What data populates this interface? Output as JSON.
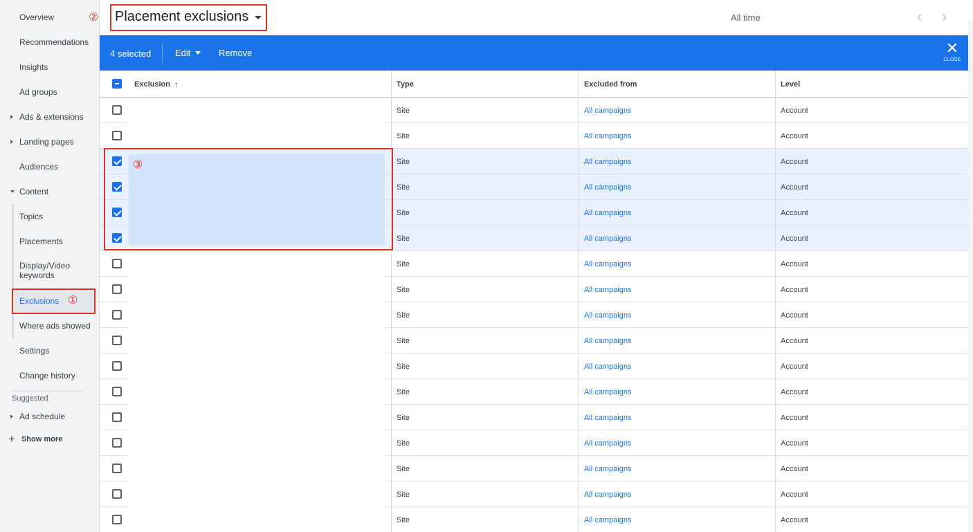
{
  "sidebar": {
    "items": [
      {
        "label": "Overview"
      },
      {
        "label": "Recommendations"
      },
      {
        "label": "Insights"
      },
      {
        "label": "Ad groups"
      },
      {
        "label": "Ads & extensions"
      },
      {
        "label": "Landing pages"
      },
      {
        "label": "Audiences"
      },
      {
        "label": "Content"
      },
      {
        "label": "Topics"
      },
      {
        "label": "Placements"
      },
      {
        "label": "Display/Video keywords"
      },
      {
        "label": "Exclusions"
      },
      {
        "label": "Where ads showed"
      },
      {
        "label": "Settings"
      },
      {
        "label": "Change history"
      }
    ],
    "suggested_label": "Suggested",
    "suggested_items": [
      {
        "label": "Ad schedule"
      }
    ],
    "show_more_label": "Show more"
  },
  "annotations": {
    "one": "①",
    "two": "②",
    "three": "③"
  },
  "header": {
    "title": "Placement exclusions",
    "date_range": "All time",
    "prev_icon": "‹",
    "next_icon": "›"
  },
  "selection_bar": {
    "count_label": "4 selected",
    "edit_label": "Edit",
    "remove_label": "Remove",
    "close_icon": "✕",
    "close_label": "CLOSE"
  },
  "table": {
    "columns": {
      "exclusion": "Exclusion",
      "type": "Type",
      "excluded_from": "Excluded from",
      "level": "Level"
    },
    "sort_icon": "↑",
    "rows": [
      {
        "type": "Site",
        "excluded_from": "All campaigns",
        "level": "Account"
      },
      {
        "type": "Site",
        "excluded_from": "All campaigns",
        "level": "Account"
      },
      {
        "type": "Site",
        "excluded_from": "All campaigns",
        "level": "Account"
      },
      {
        "type": "Site",
        "excluded_from": "All campaigns",
        "level": "Account"
      },
      {
        "type": "Site",
        "excluded_from": "All campaigns",
        "level": "Account"
      },
      {
        "type": "Site",
        "excluded_from": "All campaigns",
        "level": "Account"
      },
      {
        "type": "Site",
        "excluded_from": "All campaigns",
        "level": "Account"
      },
      {
        "type": "Site",
        "excluded_from": "All campaigns",
        "level": "Account"
      },
      {
        "type": "Site",
        "excluded_from": "All campaigns",
        "level": "Account"
      },
      {
        "type": "Site",
        "excluded_from": "All campaigns",
        "level": "Account"
      },
      {
        "type": "Site",
        "excluded_from": "All campaigns",
        "level": "Account"
      },
      {
        "type": "Site",
        "excluded_from": "All campaigns",
        "level": "Account"
      },
      {
        "type": "Site",
        "excluded_from": "All campaigns",
        "level": "Account"
      },
      {
        "type": "Site",
        "excluded_from": "All campaigns",
        "level": "Account"
      },
      {
        "type": "Site",
        "excluded_from": "All campaigns",
        "level": "Account"
      },
      {
        "type": "Site",
        "excluded_from": "All campaigns",
        "level": "Account"
      },
      {
        "type": "Site",
        "excluded_from": "All campaigns",
        "level": "Account"
      }
    ]
  },
  "colors": {
    "accent": "#1a73e8",
    "annotation": "#e0301e",
    "selected_row": "#e8f0fe"
  }
}
